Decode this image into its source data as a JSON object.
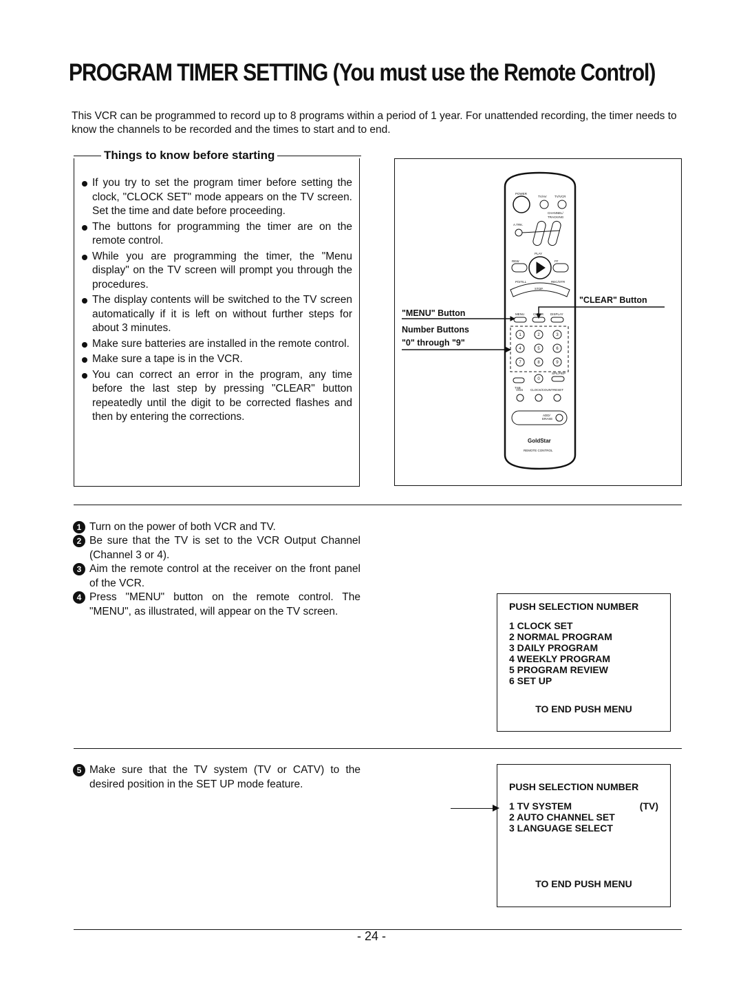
{
  "title": "PROGRAM TIMER SETTING (You must use the Remote Control)",
  "intro": "This VCR can be programmed to record up to 8 programs within a period of 1 year. For unattended recording, the timer needs to know the channels to be recorded and the times to start and to end.",
  "things": {
    "heading": "Things to know before starting",
    "items": [
      "If you try to set the program timer before setting the clock, \"CLOCK SET\" mode appears on the TV screen. Set the time and date before proceeding.",
      "The buttons for programming the timer are on the remote control.",
      "While you are programming the timer, the \"Menu display\" on the TV screen will prompt you through the procedures.",
      "The display contents will be switched to the TV screen automatically if it is left on without further steps for about 3 minutes.",
      "Make sure batteries are installed in the remote control.",
      "Make sure a tape is in the VCR.",
      "You can correct an error in the program, any time before the last step by pressing \"CLEAR\" button repeatedly until the digit to be corrected flashes and then by entering the corrections."
    ]
  },
  "remote": {
    "callout_menu": "\"MENU\" Button",
    "callout_clear": "\"CLEAR\" Button",
    "callout_numbers_1": "Number Buttons",
    "callout_numbers_2": "\"0\" through \"9\"",
    "labels": {
      "power": "POWER",
      "tvav": "TV/AV",
      "tvvcr": "TV/VCR",
      "channel": "CHANNEL/",
      "tracking": "TRACKING",
      "atrk": "A.TRK.",
      "play": "PLAY",
      "rew": "REW",
      "ff": "FF",
      "pstill": "P/STILL",
      "stop": "STOP",
      "rec": "REC/OTR",
      "menu": "MENU",
      "clear": "CLEAR",
      "display": "DISPLAY",
      "vps": "VISS",
      "clock": "CLOCK/COUNT",
      "reset": "RESET",
      "tsb": "TSB",
      "sp": "SP/LP/EP",
      "add": "ADD/",
      "erase": "ERASE",
      "brand": "GoldStar",
      "remote_control": "REMOTE CONTROL"
    },
    "digits": [
      "1",
      "2",
      "3",
      "4",
      "5",
      "6",
      "7",
      "8",
      "9",
      "0"
    ]
  },
  "steps": [
    {
      "n": "1",
      "text": "Turn on the power of both VCR and TV."
    },
    {
      "n": "2",
      "text": "Be sure that the TV is set to the VCR Output Channel (Channel 3 or 4)."
    },
    {
      "n": "3",
      "text": "Aim the remote control at the receiver on the front panel of the VCR."
    },
    {
      "n": "4",
      "text": "Press \"MENU\" button on the remote control. The \"MENU\", as illustrated, will appear on the TV screen."
    },
    {
      "n": "5",
      "text": "Make sure that the TV system (TV or CATV) to the desired position in the SET UP mode feature."
    }
  ],
  "menu1": {
    "header": "PUSH SELECTION NUMBER",
    "items": [
      "1 CLOCK SET",
      "2 NORMAL PROGRAM",
      "3 DAILY PROGRAM",
      "4 WEEKLY PROGRAM",
      "5 PROGRAM REVIEW",
      "6 SET UP"
    ],
    "footer": "TO END PUSH MENU"
  },
  "menu2": {
    "header": "PUSH SELECTION NUMBER",
    "items": [
      "1 TV SYSTEM",
      "2 AUTO CHANNEL SET",
      "3 LANGUAGE SELECT"
    ],
    "item1_value": "(TV)",
    "footer": "TO END PUSH MENU"
  },
  "page_number": "- 24 -"
}
